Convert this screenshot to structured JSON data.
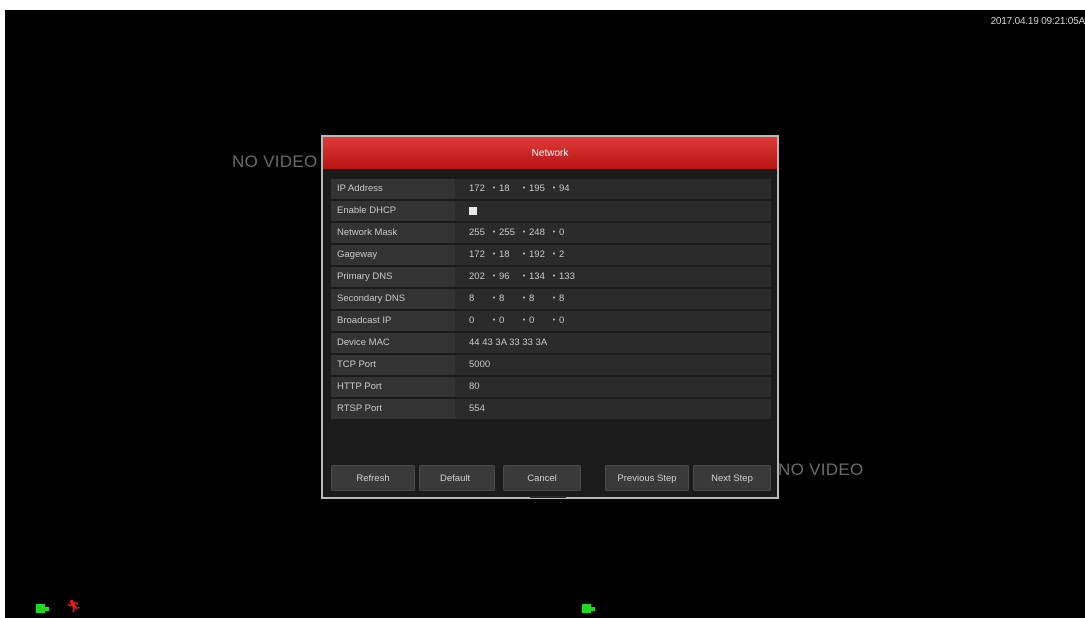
{
  "overlay": {
    "timestamp": "2017.04.19 09:21:05A",
    "no_video_1": "NO VIDEO",
    "no_video_2": "NO VIDEO"
  },
  "dialog": {
    "title": "Network",
    "fields": [
      {
        "label": "IP Address",
        "ip": [
          "172",
          "18",
          "195",
          "94"
        ]
      },
      {
        "label": "Enable DHCP",
        "checkbox": true
      },
      {
        "label": "Network Mask",
        "ip": [
          "255",
          "255",
          "248",
          "0"
        ]
      },
      {
        "label": "Gageway",
        "ip": [
          "172",
          "18",
          "192",
          "2"
        ]
      },
      {
        "label": "Primary DNS",
        "ip": [
          "202",
          "96",
          "134",
          "133"
        ]
      },
      {
        "label": "Secondary DNS",
        "ip": [
          "8",
          "8",
          "8",
          "8"
        ]
      },
      {
        "label": "Broadcast IP",
        "ip": [
          "0",
          "0",
          "0",
          "0"
        ]
      },
      {
        "label": "Device MAC",
        "value": "44 43 3A 33 33 3A"
      },
      {
        "label": "TCP Port",
        "value": "5000"
      },
      {
        "label": "HTTP Port",
        "value": "80"
      },
      {
        "label": "RTSP Port",
        "value": "554"
      }
    ],
    "buttons": {
      "refresh": "Refresh",
      "default": "Default",
      "cancel": "Cancel",
      "previous": "Previous Step",
      "next": "Next Step"
    }
  },
  "icons": {
    "camera": "camera-icon",
    "motion": "motion-person-icon"
  },
  "colors": {
    "title_bar": "#c41e1e",
    "camera_green": "#1fd81f",
    "motion_red": "#e21b1b"
  }
}
